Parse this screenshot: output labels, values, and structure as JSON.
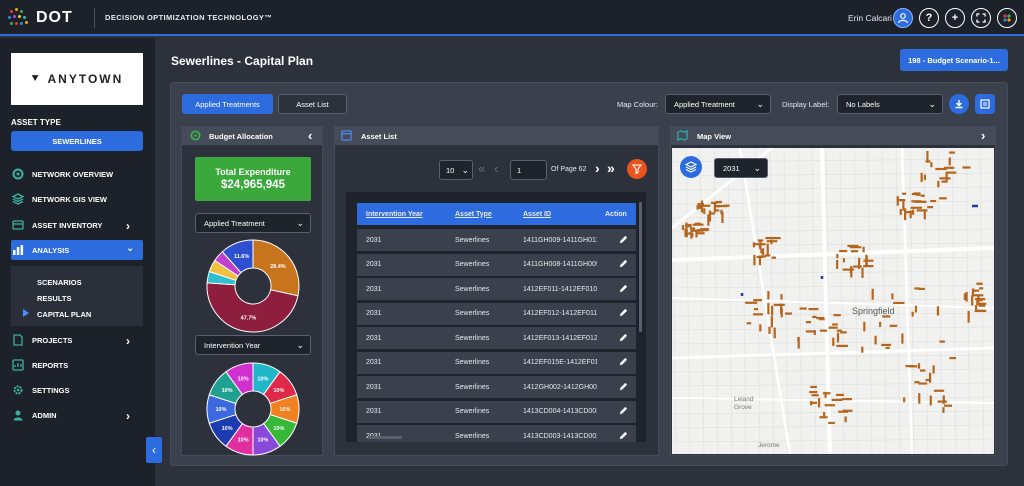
{
  "app": {
    "brand": "DOT",
    "tagline": "DECISION OPTIMIZATION TECHNOLOGY™",
    "user_name": "Erin Calcari",
    "help_glyph": "?",
    "add_glyph": "+"
  },
  "sidebar": {
    "client_logo": "ANYTOWN",
    "asset_type_label": "ASSET TYPE",
    "asset_type_value": "SEWERLINES",
    "items": [
      {
        "label": "NETWORK OVERVIEW",
        "icon": "network-icon"
      },
      {
        "label": "NETWORK GIS VIEW",
        "icon": "layers-icon"
      },
      {
        "label": "ASSET INVENTORY",
        "icon": "inventory-icon"
      },
      {
        "label": "ANALYSIS",
        "icon": "chart-icon"
      },
      {
        "label": "PROJECTS",
        "icon": "projects-icon"
      },
      {
        "label": "REPORTS",
        "icon": "reports-icon"
      },
      {
        "label": "SETTINGS",
        "icon": "gear-icon"
      },
      {
        "label": "ADMIN",
        "icon": "admin-icon"
      }
    ],
    "sub_items": [
      "SCENARIOS",
      "RESULTS",
      "CAPITAL PLAN"
    ]
  },
  "main": {
    "title": "Sewerlines - Capital Plan",
    "scenario_button": "198 - Budget Scenario-1...",
    "tabs": [
      "Applied Treatments",
      "Asset List"
    ],
    "map_colour_label": "Map Colour:",
    "map_colour_value": "Applied Treatment",
    "display_label_label": "Display Label:",
    "display_label_value": "No Labels"
  },
  "budget": {
    "title": "Budget Allocation",
    "total_label": "Total Expenditure",
    "total_value": "$24,965,945",
    "select1": "Applied Treatment",
    "select2": "Intervention Year",
    "pie1": {
      "slices": [
        {
          "value": 28.4,
          "color": "#c8741c",
          "label": "28.4%"
        },
        {
          "value": 47.7,
          "color": "#8e1e3e",
          "label": "47.7%"
        },
        {
          "value": 4.0,
          "color": "#2fbfd0",
          "label": ""
        },
        {
          "value": 4.3,
          "color": "#f0c040",
          "label": ""
        },
        {
          "value": 4.0,
          "color": "#c040d0",
          "label": ""
        },
        {
          "value": 11.6,
          "color": "#2d4fd0",
          "label": "11.6%"
        }
      ]
    },
    "pie2": {
      "slices": [
        {
          "value": 10,
          "color": "#20b8c8",
          "label": "10%"
        },
        {
          "value": 10,
          "color": "#e02848",
          "label": "10%"
        },
        {
          "value": 10,
          "color": "#f08020",
          "label": "10%"
        },
        {
          "value": 10,
          "color": "#38b838",
          "label": "10%"
        },
        {
          "value": 10,
          "color": "#8848d8",
          "label": "10%"
        },
        {
          "value": 10,
          "color": "#e030a0",
          "label": "10%"
        },
        {
          "value": 10,
          "color": "#1c3cb0",
          "label": "10%"
        },
        {
          "value": 10,
          "color": "#3c68e0",
          "label": "10%"
        },
        {
          "value": 10,
          "color": "#20a090",
          "label": "10%"
        },
        {
          "value": 10,
          "color": "#d030d0",
          "label": "10%"
        }
      ]
    }
  },
  "asset_list": {
    "title": "Asset List",
    "page_size": "10",
    "page": "1",
    "page_of": "Of Page 62",
    "columns": [
      "Intervention Year",
      "Asset Type",
      "Asset ID",
      "Action"
    ],
    "rows": [
      [
        "2031",
        "Sewerlines",
        "1411GH009-1411GH011"
      ],
      [
        "2031",
        "Sewerlines",
        "1411GH008-1411GH009"
      ],
      [
        "2031",
        "Sewerlines",
        "1412EF011-1412EF010"
      ],
      [
        "2031",
        "Sewerlines",
        "1412EF012-1412EF011"
      ],
      [
        "2031",
        "Sewerlines",
        "1412EF013-1412EF012"
      ],
      [
        "2031",
        "Sewerlines",
        "1412EF015E-1412EF013"
      ],
      [
        "2031",
        "Sewerlines",
        "1412GH002-1412GH001"
      ],
      [
        "2031",
        "Sewerlines",
        "1413CD004-1413CD003"
      ],
      [
        "2031",
        "Sewerlines",
        "1413CD003-1413CD002"
      ]
    ]
  },
  "map": {
    "title": "Map View",
    "year": "2031",
    "places": [
      "Springfield",
      "Leland Grove",
      "Jerome"
    ],
    "segment_color": "#b5651d"
  }
}
